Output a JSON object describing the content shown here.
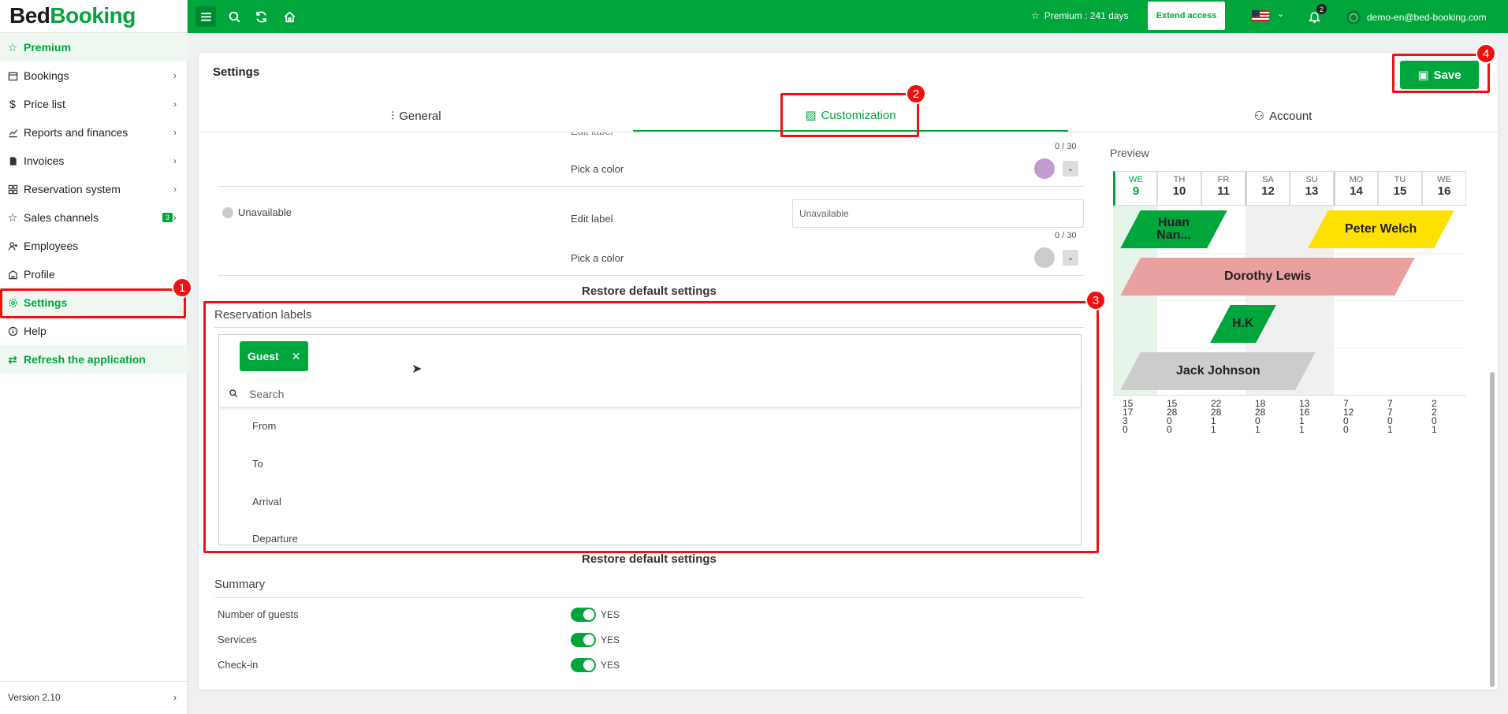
{
  "logo": {
    "bed": "Bed",
    "booking": "Booking"
  },
  "topbar": {
    "premium": "Premium : 241 days",
    "extend": "Extend access",
    "notifications": "2",
    "user": "demo-en@bed-booking.com"
  },
  "sidebar": {
    "items": [
      {
        "label": "Premium"
      },
      {
        "label": "Bookings"
      },
      {
        "label": "Price list"
      },
      {
        "label": "Reports and finances"
      },
      {
        "label": "Invoices"
      },
      {
        "label": "Reservation system"
      },
      {
        "label": "Sales channels",
        "badge": "3"
      },
      {
        "label": "Employees"
      },
      {
        "label": "Profile"
      },
      {
        "label": "Settings"
      },
      {
        "label": "Help"
      },
      {
        "label": "Refresh the application"
      }
    ],
    "version": "Version 2.10"
  },
  "page": {
    "title": "Settings",
    "save": "Save",
    "tabs": [
      {
        "label": "General"
      },
      {
        "label": "Customization"
      },
      {
        "label": "Account"
      }
    ]
  },
  "status_rows": [
    {
      "edit_label": "Edit label",
      "counter": "0 / 30",
      "pick_color": "Pick a color",
      "color": "#c39bd3"
    },
    {
      "name": "Unavailable",
      "edit_label": "Edit label",
      "value": "Unavailable",
      "counter": "0 / 30",
      "pick_color": "Pick a color",
      "color": "#cccccc"
    }
  ],
  "restore": "Restore default settings",
  "reservation_labels": {
    "title": "Reservation labels",
    "chip": "Guest",
    "search_placeholder": "Search",
    "options": [
      "From",
      "To",
      "Arrival",
      "Departure"
    ]
  },
  "summary": {
    "title": "Summary",
    "rows": [
      {
        "label": "Number of guests",
        "value": "YES"
      },
      {
        "label": "Services",
        "value": "YES"
      },
      {
        "label": "Check-in",
        "value": "YES"
      }
    ]
  },
  "preview": {
    "title": "Preview",
    "days": [
      {
        "dow": "WE",
        "num": "9"
      },
      {
        "dow": "TH",
        "num": "10"
      },
      {
        "dow": "FR",
        "num": "11"
      },
      {
        "dow": "SA",
        "num": "12"
      },
      {
        "dow": "SU",
        "num": "13"
      },
      {
        "dow": "MO",
        "num": "14"
      },
      {
        "dow": "TU",
        "num": "15"
      },
      {
        "dow": "WE",
        "num": "16"
      }
    ],
    "reservations": [
      {
        "name": "Huan Nan...",
        "color": "#00a63c"
      },
      {
        "name": "Peter Welch",
        "color": "#ffe000"
      },
      {
        "name": "Dorothy Lewis",
        "color": "#e8a0a0"
      },
      {
        "name": "H.K",
        "color": "#00a63c"
      },
      {
        "name": "Jack Johnson",
        "color": "#cccccc"
      }
    ],
    "stats": [
      [
        "15",
        "17",
        "3",
        "0"
      ],
      [
        "15",
        "28",
        "0",
        "0"
      ],
      [
        "22",
        "28",
        "1",
        "1"
      ],
      [
        "18",
        "28",
        "0",
        "1"
      ],
      [
        "13",
        "16",
        "1",
        "1"
      ],
      [
        "7",
        "12",
        "0",
        "0"
      ],
      [
        "7",
        "7",
        "0",
        "1"
      ],
      [
        "2",
        "2",
        "0",
        "1"
      ]
    ]
  },
  "annotations": [
    "1",
    "2",
    "3",
    "4"
  ]
}
